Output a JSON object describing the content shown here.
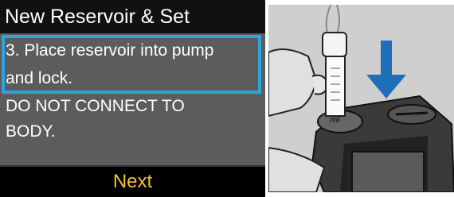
{
  "screen": {
    "title": "New Reservoir & Set",
    "lines": [
      "3. Place reservoir into pump",
      "and lock.",
      "DO NOT CONNECT TO",
      "BODY."
    ],
    "next_label": "Next",
    "colors": {
      "highlight": "#2aa6df",
      "next_text": "#f2c12e",
      "arrow": "#1f6fb8"
    }
  },
  "illustration": {
    "arrow_icon": "arrow-down-icon",
    "label": "ml"
  }
}
